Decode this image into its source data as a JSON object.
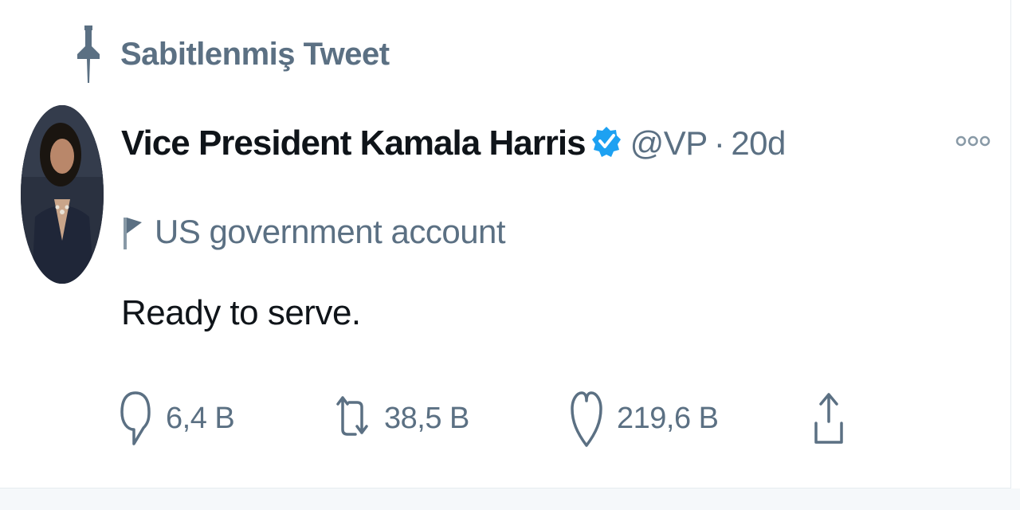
{
  "pinned": {
    "label": "Sabitlenmiş Tweet",
    "icon": "pin-icon"
  },
  "author": {
    "display_name": "Vice President Kamala Harris",
    "verified_icon": "verified-badge-icon",
    "handle": "@VP",
    "separator": "·",
    "time": "20d"
  },
  "account_label": {
    "icon": "flag-icon",
    "text": "US government account"
  },
  "tweet": {
    "text": "Ready to serve."
  },
  "actions": {
    "reply": {
      "icon": "reply-icon",
      "count": "6,4 B"
    },
    "retweet": {
      "icon": "retweet-icon",
      "count": "38,5 B"
    },
    "like": {
      "icon": "heart-icon",
      "count": "219,6 B"
    },
    "share": {
      "icon": "share-icon"
    }
  },
  "colors": {
    "text_primary": "#0f1419",
    "text_secondary": "#5b7083",
    "verified_blue": "#1da1f2",
    "border": "#e6ecf0",
    "page_background": "#f5f8fa"
  }
}
